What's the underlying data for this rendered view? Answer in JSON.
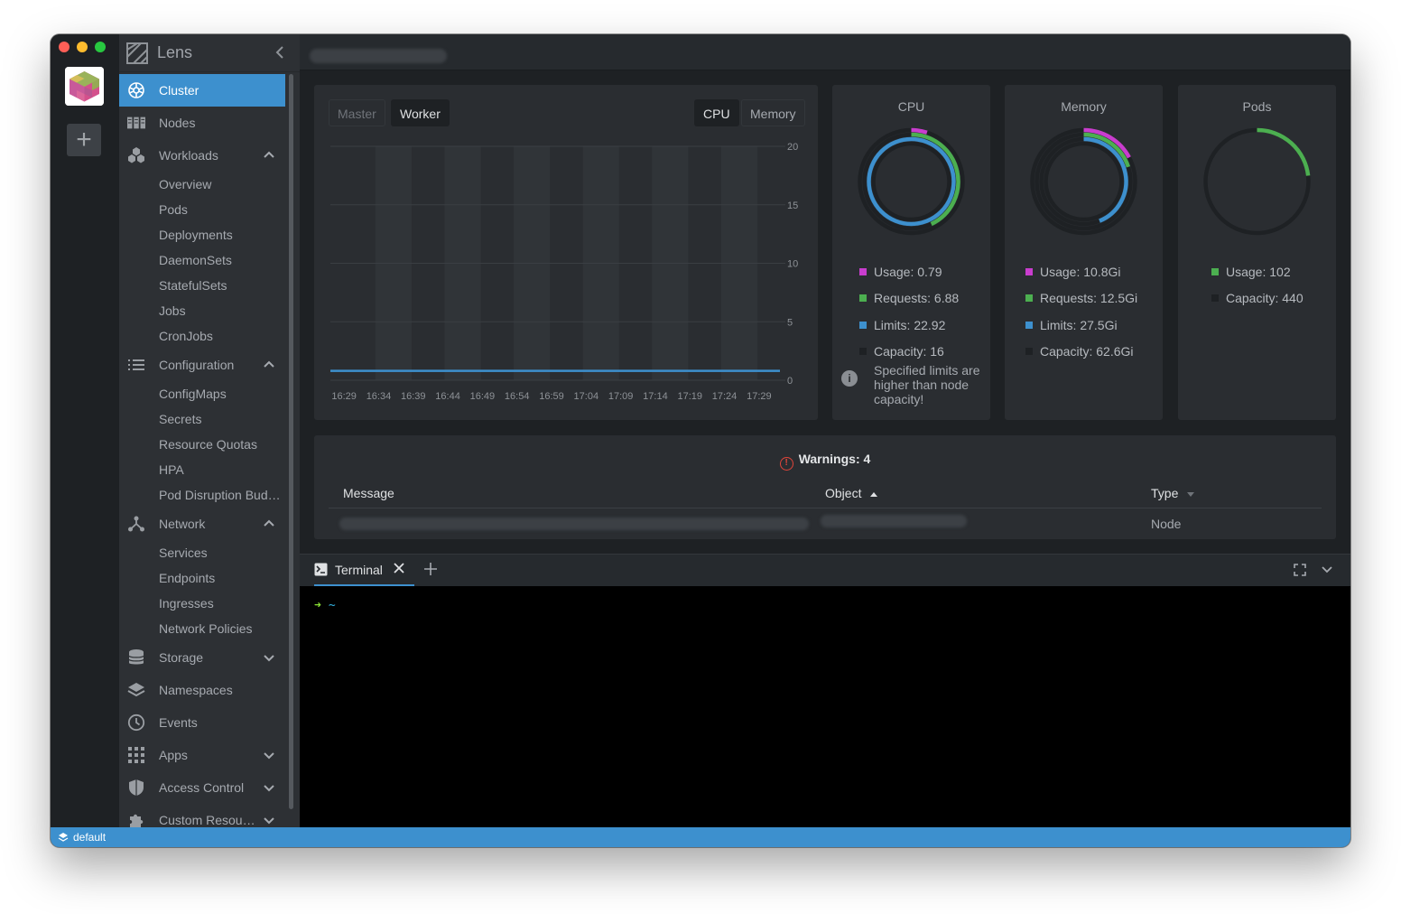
{
  "app": {
    "name": "Lens"
  },
  "colors": {
    "accent": "#3d90ce",
    "usage": "#c93dce",
    "requests": "#4caf50",
    "limits": "#3d90ce",
    "capacity": "#1e2124"
  },
  "sidebar": {
    "items": [
      {
        "label": "Cluster",
        "icon": "kubernetes-wheel-icon",
        "active": true
      },
      {
        "label": "Nodes",
        "icon": "nodes-icon"
      },
      {
        "label": "Workloads",
        "icon": "workloads-icon",
        "expanded": true,
        "children": [
          "Overview",
          "Pods",
          "Deployments",
          "DaemonSets",
          "StatefulSets",
          "Jobs",
          "CronJobs"
        ]
      },
      {
        "label": "Configuration",
        "icon": "list-icon",
        "expanded": true,
        "children": [
          "ConfigMaps",
          "Secrets",
          "Resource Quotas",
          "HPA",
          "Pod Disruption Budgets"
        ]
      },
      {
        "label": "Network",
        "icon": "network-icon",
        "expanded": true,
        "children": [
          "Services",
          "Endpoints",
          "Ingresses",
          "Network Policies"
        ]
      },
      {
        "label": "Storage",
        "icon": "storage-icon",
        "expanded": false
      },
      {
        "label": "Namespaces",
        "icon": "layers-icon"
      },
      {
        "label": "Events",
        "icon": "clock-icon"
      },
      {
        "label": "Apps",
        "icon": "apps-grid-icon",
        "expanded": false
      },
      {
        "label": "Access Control",
        "icon": "shield-icon",
        "expanded": false
      },
      {
        "label": "Custom Resources",
        "icon": "puzzle-icon",
        "expanded": false
      }
    ]
  },
  "metrics": {
    "tabs": {
      "master": "Master",
      "worker": "Worker",
      "cpu": "CPU",
      "memory": "Memory"
    },
    "active_tabs": [
      "Worker",
      "CPU"
    ]
  },
  "chart_data": {
    "type": "line",
    "x": [
      "16:29",
      "16:34",
      "16:39",
      "16:44",
      "16:49",
      "16:54",
      "16:59",
      "17:04",
      "17:09",
      "17:14",
      "17:19",
      "17:24",
      "17:29"
    ],
    "series": [
      {
        "values": [
          0.8,
          0.8,
          0.8,
          0.8,
          0.8,
          0.8,
          0.8,
          0.8,
          0.8,
          0.8,
          0.8,
          0.8,
          0.8
        ]
      }
    ],
    "yticks": [
      0,
      5,
      10,
      15,
      20
    ],
    "ylim": [
      0,
      20
    ],
    "grid": true
  },
  "cpu": {
    "title": "CPU",
    "usage": "Usage: 0.79",
    "requests": "Requests: 6.88",
    "limits": "Limits: 22.92",
    "capacity": "Capacity: 16",
    "usage_value": 0.79,
    "requests_value": 6.88,
    "limits_value": 22.92,
    "capacity_value": 16,
    "note": "Specified limits are higher than node capacity!"
  },
  "memory": {
    "title": "Memory",
    "usage": "Usage: 10.8Gi",
    "requests": "Requests: 12.5Gi",
    "limits": "Limits: 27.5Gi",
    "capacity": "Capacity: 62.6Gi",
    "usage_value": 10.8,
    "requests_value": 12.5,
    "limits_value": 27.5,
    "capacity_value": 62.6
  },
  "pods": {
    "title": "Pods",
    "usage": "Usage: 102",
    "capacity": "Capacity: 440",
    "usage_value": 102,
    "capacity_value": 440
  },
  "warnings": {
    "title": "Warnings: 4",
    "columns": {
      "message": "Message",
      "object": "Object",
      "type": "Type"
    },
    "rows": [
      {
        "type": "Node"
      }
    ]
  },
  "dock": {
    "terminal_label": "Terminal",
    "prompt_arrow": "➜",
    "prompt_dir": "~"
  },
  "statusbar": {
    "namespace": "default"
  }
}
